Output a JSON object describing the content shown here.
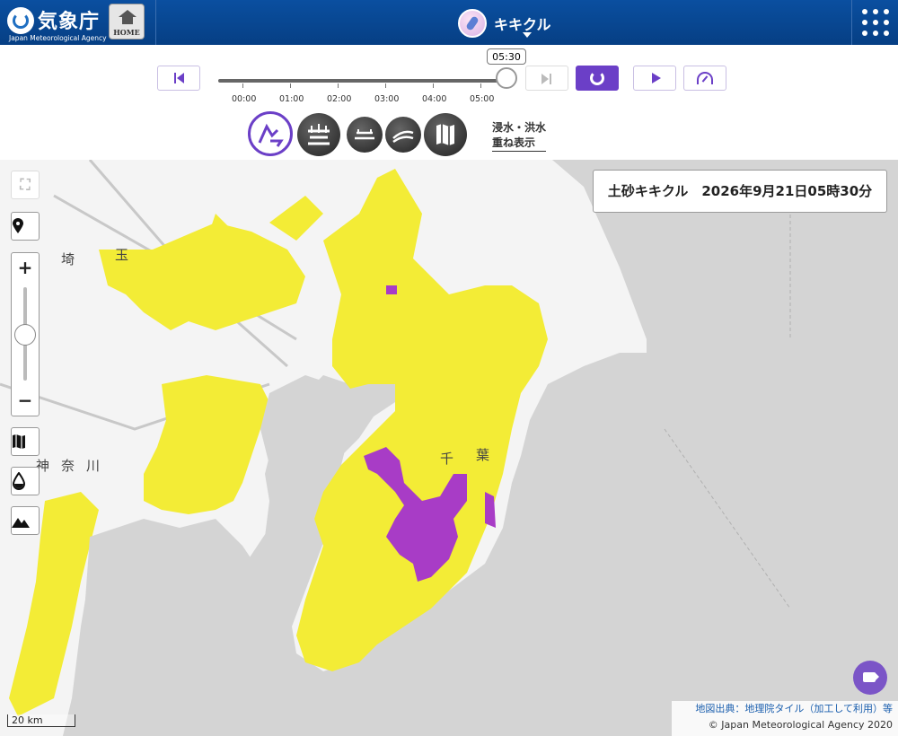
{
  "header": {
    "agency_name": "気象庁",
    "agency_name_en": "Japan Meteorological Agency",
    "home_label": "HOME",
    "mode_title": "キキクル"
  },
  "playback": {
    "current_time_tooltip": "05:30",
    "ticks": [
      "00:00",
      "01:00",
      "02:00",
      "03:00",
      "04:00",
      "05:00"
    ],
    "position_fraction": 1.0
  },
  "layers": {
    "overlay_label_line1": "浸水・洪水",
    "overlay_label_line2": "重ね表示"
  },
  "map": {
    "datetime_box": "土砂キキクル　2026年9月21日05時30分",
    "zoom_in": "+",
    "zoom_out": "−",
    "zoom_level_fraction": 0.5,
    "scale_label": "20 km",
    "attribution_line1": "地図出典：地理院タイル（加工して利用）等",
    "attribution_line2": "© Japan Meteorological Agency 2020",
    "place_labels": [
      "埼",
      "玉",
      "千",
      "葉",
      "神",
      "奈",
      "川"
    ],
    "colors": {
      "warning_yellow": "#f3ec36",
      "danger_purple": "#a83cc6",
      "land": "#f4f4f4",
      "sea": "#d4d4d4",
      "accent": "#6b3fc7"
    }
  }
}
